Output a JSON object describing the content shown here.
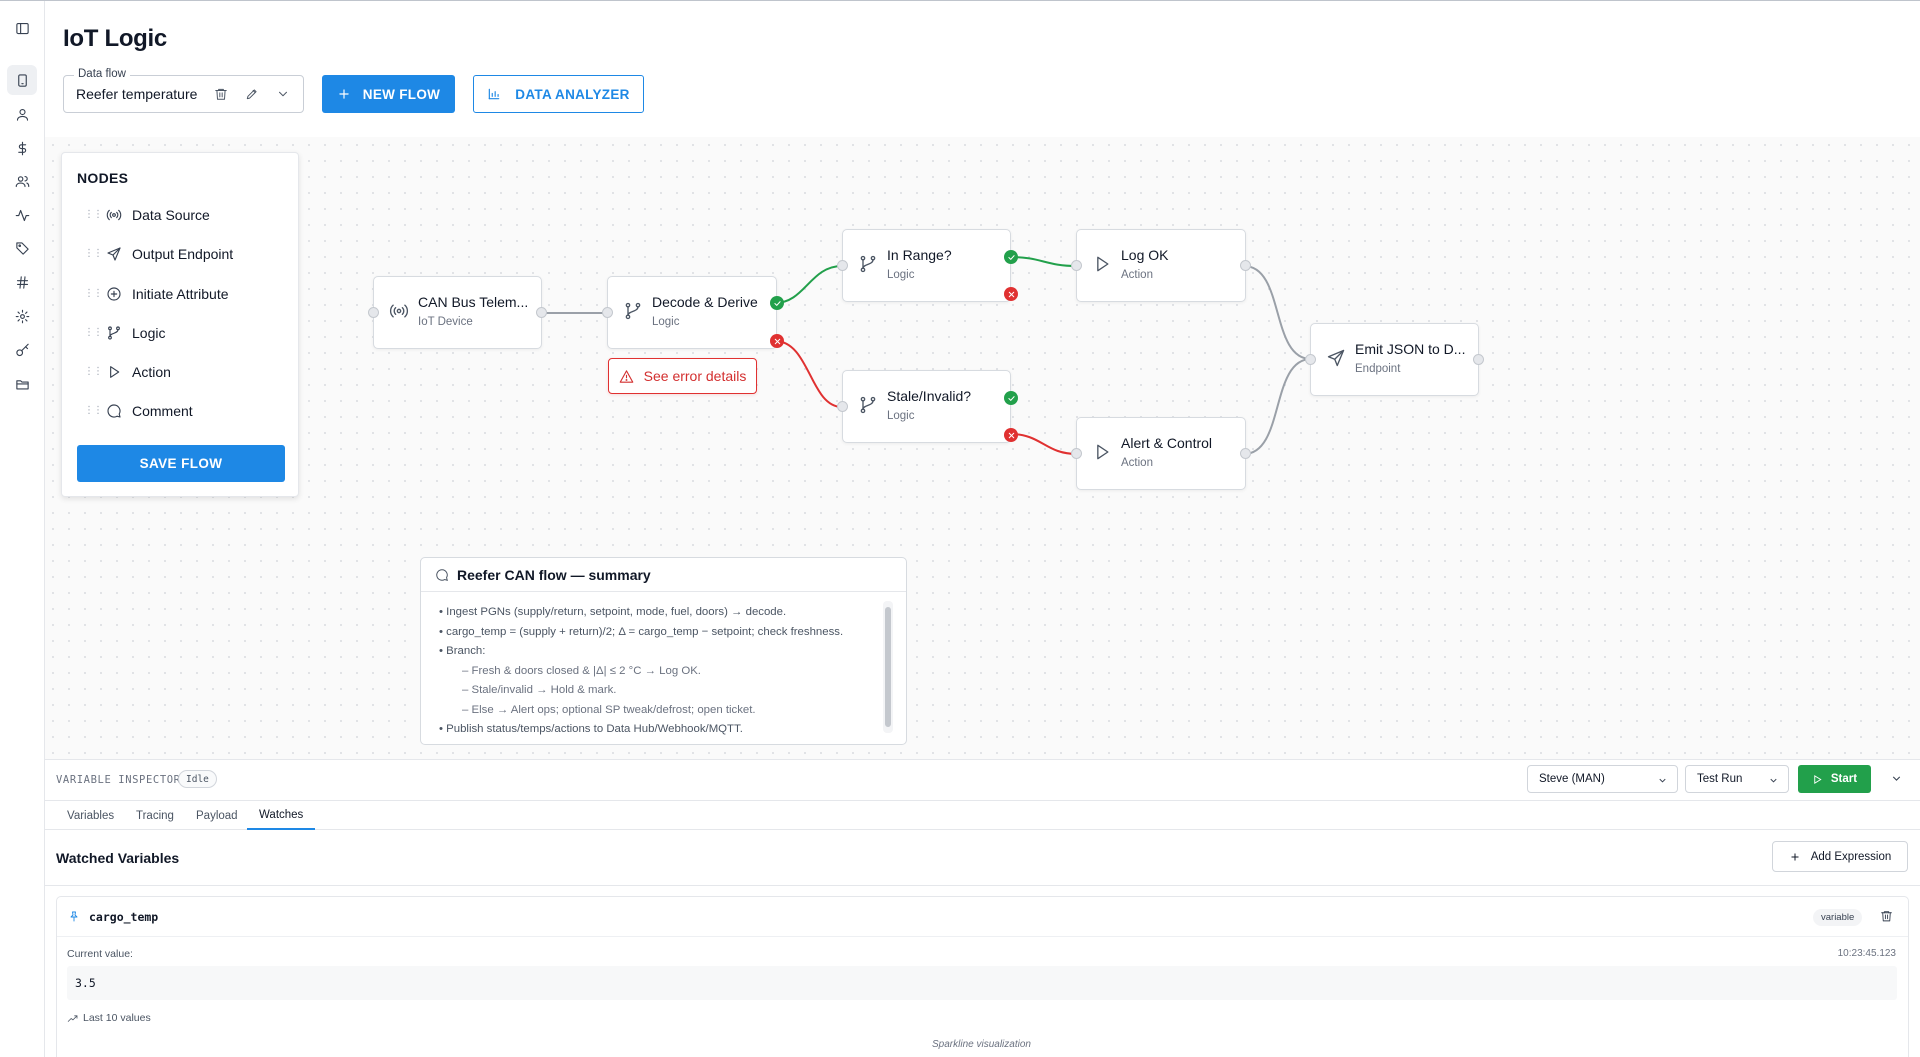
{
  "page": {
    "title": "IoT Logic"
  },
  "sidebar": {
    "icons": [
      "sidebar-toggle-icon",
      "device-icon",
      "user-icon",
      "dollar-icon",
      "users-icon",
      "activity-icon",
      "tag-icon",
      "hash-icon",
      "gear-icon",
      "key-icon",
      "folder-icon"
    ]
  },
  "toolbar": {
    "flow_legend": "Data flow",
    "flow_value": "Reefer temperature",
    "new_flow": "NEW FLOW",
    "data_analyzer": "DATA ANALYZER"
  },
  "nodes_panel": {
    "title": "NODES",
    "items": [
      {
        "label": "Data Source",
        "icon": "broadcast-icon"
      },
      {
        "label": "Output Endpoint",
        "icon": "send-icon"
      },
      {
        "label": "Initiate Attribute",
        "icon": "plus-circle-icon"
      },
      {
        "label": "Logic",
        "icon": "branch-icon"
      },
      {
        "label": "Action",
        "icon": "play-icon"
      },
      {
        "label": "Comment",
        "icon": "comment-icon"
      }
    ],
    "save": "SAVE FLOW"
  },
  "flow": {
    "nodes": [
      {
        "id": "can",
        "title": "CAN Bus Telem...",
        "sub": "IoT Device"
      },
      {
        "id": "decode",
        "title": "Decode & Derive",
        "sub": "Logic"
      },
      {
        "id": "inrange",
        "title": "In Range?",
        "sub": "Logic"
      },
      {
        "id": "stale",
        "title": "Stale/Invalid?",
        "sub": "Logic"
      },
      {
        "id": "logok",
        "title": "Log OK",
        "sub": "Action"
      },
      {
        "id": "alert",
        "title": "Alert & Control",
        "sub": "Action"
      },
      {
        "id": "emit",
        "title": "Emit JSON to D...",
        "sub": "Endpoint"
      }
    ],
    "error_button": "See error details",
    "colors": {
      "ok": "#22a04b",
      "error": "#e03131",
      "neutral": "#9aa0a8",
      "accent": "#1e88e5"
    }
  },
  "comment": {
    "title": "Reefer CAN flow — summary",
    "lines": [
      "• Ingest PGNs (supply/return, setpoint, mode, fuel, doors) → decode.",
      "• cargo_temp = (supply + return)/2; Δ = cargo_temp − setpoint; check freshness.",
      "• Branch:",
      "– Fresh & doors closed & |Δ| ≤ 2 °C → Log OK.",
      "– Stale/invalid → Hold & mark.",
      "– Else → Alert ops; optional SP tweak/defrost; open ticket.",
      "• Publish status/temps/actions to Data Hub/Webhook/MQTT."
    ]
  },
  "inspector": {
    "label": "VARIABLE INSPECTOR",
    "status": "Idle",
    "user_select": "Steve (MAN)",
    "mode_select": "Test Run",
    "start": "Start",
    "tabs": [
      "Variables",
      "Tracing",
      "Payload",
      "Watches"
    ],
    "active_tab": "Watches",
    "watched_title": "Watched Variables",
    "add_expression": "Add Expression",
    "watch": {
      "name": "cargo_temp",
      "type": "variable",
      "current_label": "Current value:",
      "time": "10:23:45.123",
      "value": "3.5",
      "last_label": "Last 10 values",
      "spark_label": "Sparkline visualization"
    }
  }
}
